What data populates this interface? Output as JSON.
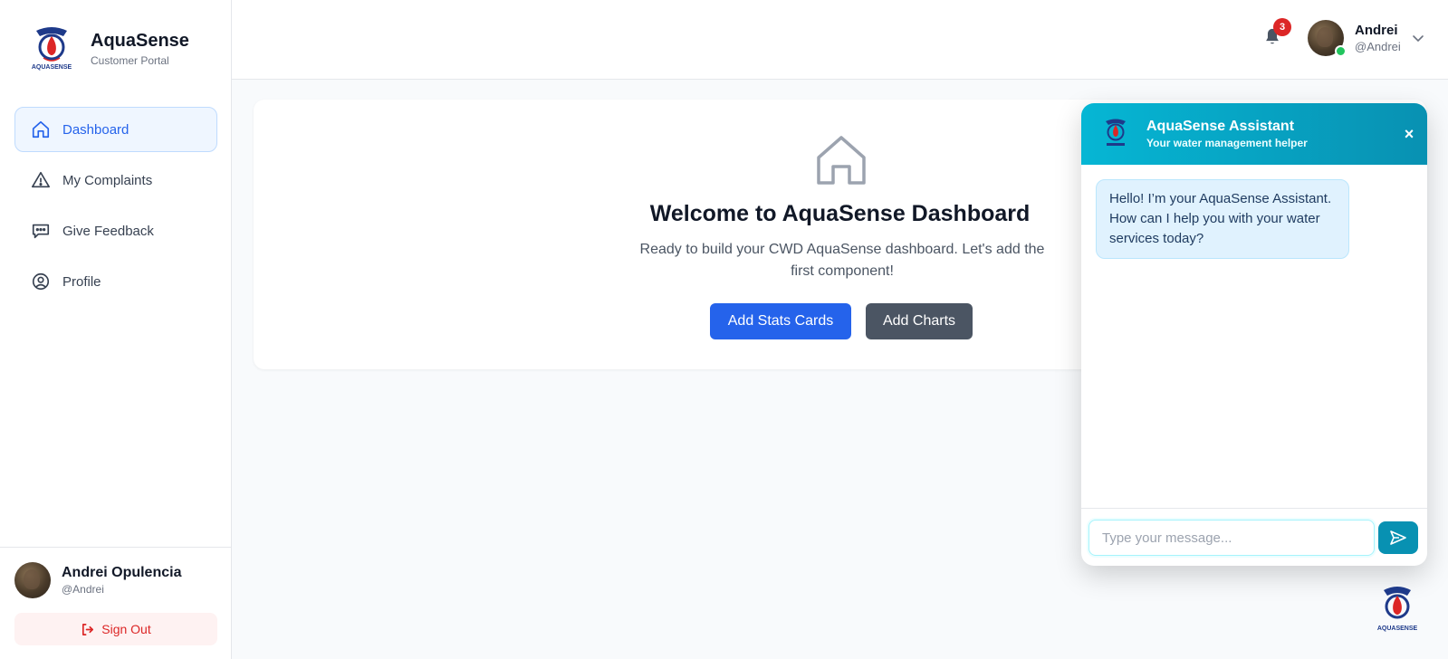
{
  "brand": {
    "title": "AquaSense",
    "subtitle": "Customer Portal",
    "logo_text": "AQUASENSE"
  },
  "sidebar": {
    "items": [
      {
        "label": "Dashboard",
        "icon": "home-icon",
        "active": true
      },
      {
        "label": "My Complaints",
        "icon": "warning-icon"
      },
      {
        "label": "Give Feedback",
        "icon": "chat-bubble-icon"
      },
      {
        "label": "Profile",
        "icon": "user-circle-icon"
      }
    ],
    "user": {
      "name": "Andrei Opulencia",
      "handle": "@Andrei"
    },
    "signout_label": "Sign Out"
  },
  "topbar": {
    "notification_count": "3",
    "user": {
      "name": "Andrei",
      "handle": "@Andrei"
    }
  },
  "welcome": {
    "title": "Welcome to AquaSense Dashboard",
    "description": "Ready to build your CWD AquaSense dashboard. Let's add the first component!",
    "buttons": {
      "stats": "Add Stats Cards",
      "charts": "Add Charts"
    }
  },
  "chat": {
    "title": "AquaSense Assistant",
    "subtitle": "Your water management helper",
    "close_label": "×",
    "message": "Hello! I’m your AquaSense Assistant. How can I help you with your water services today?",
    "input_placeholder": "Type your message..."
  },
  "colors": {
    "primary": "#2563eb",
    "accent": "#0891b2",
    "danger": "#dc2626",
    "success": "#22c55e"
  }
}
